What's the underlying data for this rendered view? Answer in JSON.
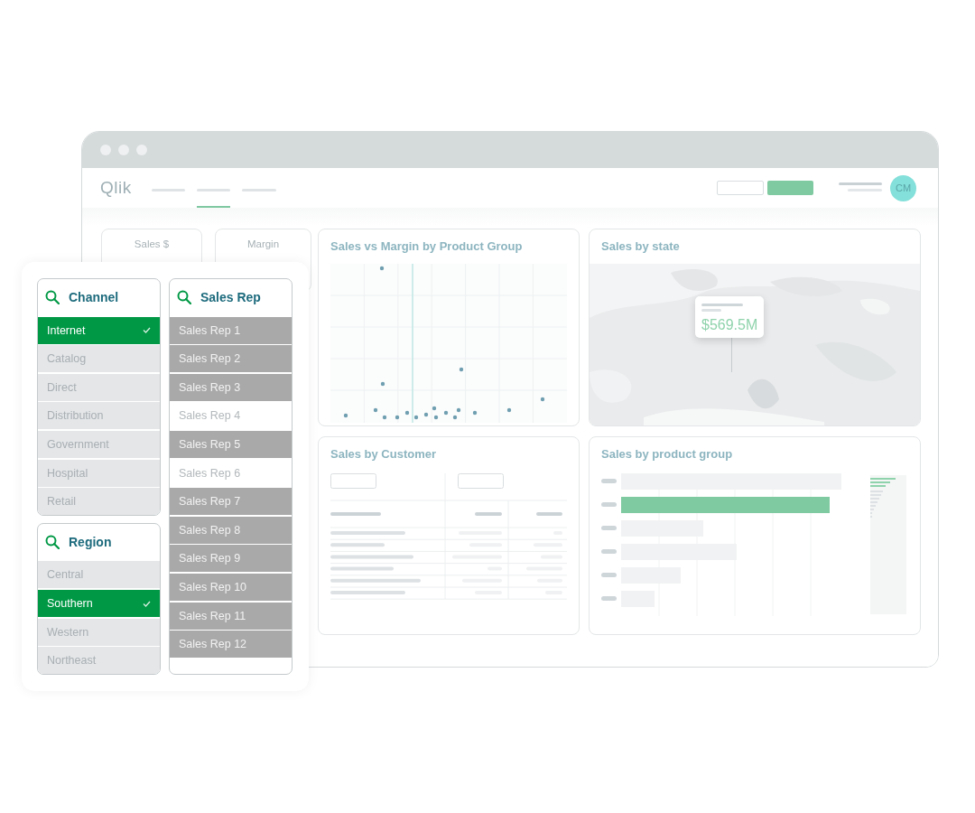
{
  "window": {
    "logo": "Qlik",
    "avatar": "CM"
  },
  "kpis": [
    {
      "label": "Sales $"
    },
    {
      "label": "Margin"
    }
  ],
  "charts": [
    {
      "kind": "scatter",
      "title": "Sales vs Margin by Product Group"
    },
    {
      "kind": "map",
      "title": "Sales by state",
      "tooltip": "$569.5M"
    },
    {
      "kind": "table",
      "title": "Sales by Customer"
    },
    {
      "kind": "bars",
      "title": "Sales by product group"
    }
  ],
  "filters_left": [
    {
      "title": "Channel",
      "items": [
        {
          "label": "Internet",
          "selected": true
        },
        {
          "label": "Catalog",
          "selected": false,
          "alternative": true
        },
        {
          "label": "Direct",
          "selected": false,
          "alternative": true
        },
        {
          "label": "Distribution",
          "selected": false,
          "alternative": true
        },
        {
          "label": "Government",
          "selected": false,
          "alternative": true
        },
        {
          "label": "Hospital",
          "selected": false,
          "alternative": true
        },
        {
          "label": "Retail",
          "selected": false,
          "alternative": true
        }
      ]
    },
    {
      "title": "Region",
      "items": [
        {
          "label": "Central",
          "selected": false,
          "alternative": true
        },
        {
          "label": "Southern",
          "selected": true
        },
        {
          "label": "Western",
          "selected": false,
          "alternative": true
        },
        {
          "label": "Northeast",
          "selected": false,
          "alternative": true
        }
      ]
    }
  ],
  "filters_right": [
    {
      "title": "Sales Rep",
      "items": [
        {
          "label": "Sales Rep 1",
          "selected": false,
          "excluded": true
        },
        {
          "label": "Sales Rep 2",
          "selected": false,
          "excluded": true
        },
        {
          "label": "Sales Rep 3",
          "selected": false,
          "excluded": true
        },
        {
          "label": "Sales Rep 4",
          "selected": false,
          "excluded": false
        },
        {
          "label": "Sales Rep 5",
          "selected": false,
          "excluded": true
        },
        {
          "label": "Sales Rep 6",
          "selected": false,
          "excluded": false
        },
        {
          "label": "Sales Rep 7",
          "selected": false,
          "excluded": true
        },
        {
          "label": "Sales Rep 8",
          "selected": false,
          "excluded": true
        },
        {
          "label": "Sales Rep 9",
          "selected": false,
          "excluded": true
        },
        {
          "label": "Sales Rep 10",
          "selected": false,
          "excluded": true
        },
        {
          "label": "Sales Rep 11",
          "selected": false,
          "excluded": true
        },
        {
          "label": "Sales Rep 12",
          "selected": false,
          "excluded": true
        }
      ]
    }
  ]
}
